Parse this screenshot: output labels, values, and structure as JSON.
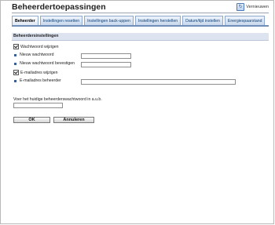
{
  "page": {
    "title": "Beheerdertoepassingen",
    "refresh_label": "Vernieuwen"
  },
  "tabs": [
    {
      "label": "Beheerder",
      "active": true
    },
    {
      "label": "Instellingen resetten",
      "active": false
    },
    {
      "label": "Instellingen back-uppen",
      "active": false
    },
    {
      "label": "Instellingen herstellen",
      "active": false
    },
    {
      "label": "Datum/tijd instellen",
      "active": false
    },
    {
      "label": "Energiespaarstand",
      "active": false
    }
  ],
  "section": {
    "title": "Beheerdersinstellingen"
  },
  "fields": {
    "change_password_label": "Wachtwoord wijzigen",
    "change_password_checked": true,
    "new_password_label": "Nieuw wachtwoord",
    "new_password_value": "",
    "confirm_password_label": "Nieuw wachtwoord bevestigen",
    "confirm_password_value": "",
    "change_email_label": "E-mailadres wijzigen",
    "change_email_checked": true,
    "admin_email_label": "E-mailadres beheerder",
    "admin_email_value": ""
  },
  "current_password": {
    "prompt": "Voer het huidige beheerderswachtwoord in a.u.b.",
    "value": ""
  },
  "buttons": {
    "ok": "OK",
    "cancel": "Annuleren"
  },
  "colors": {
    "tab_bar": "#6f8fb8",
    "section_header": "#dde4ef",
    "tab_text": "#0c3f78"
  }
}
